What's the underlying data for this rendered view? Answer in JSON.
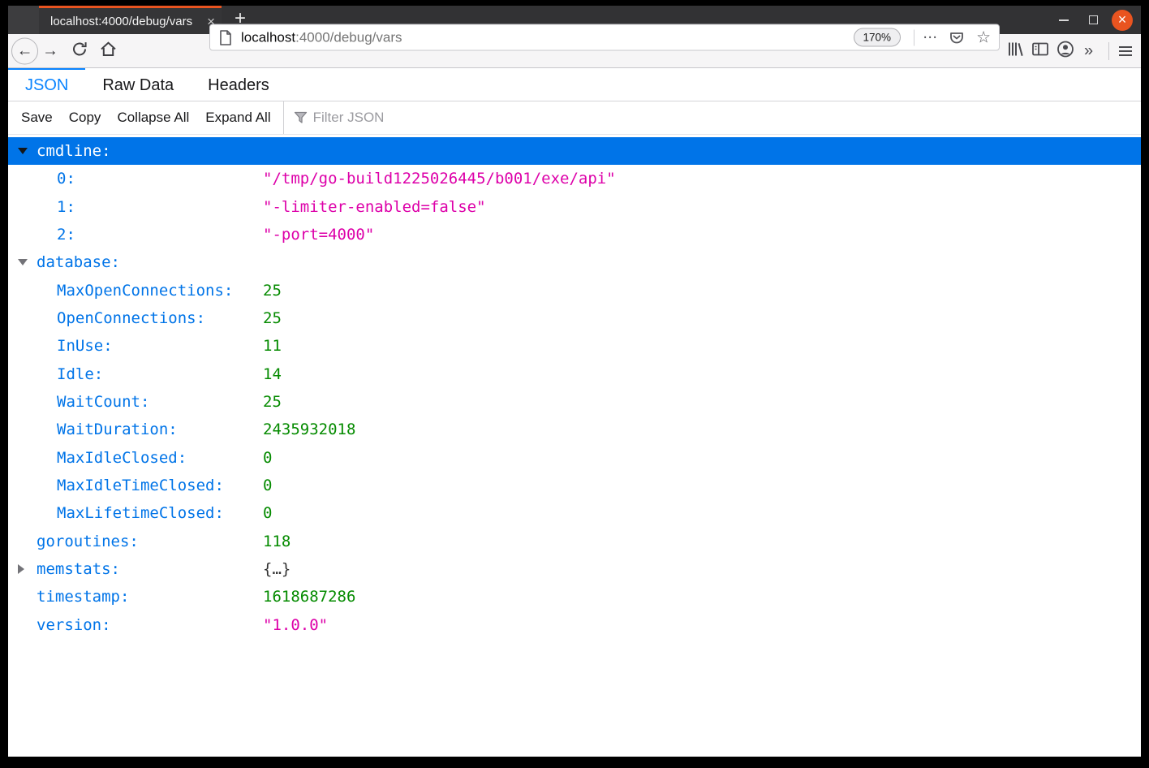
{
  "browser": {
    "tab_title": "localhost:4000/debug/vars",
    "new_tab_button": "+",
    "tab_close_glyph": "×",
    "url": {
      "host": "localhost",
      "path": ":4000/debug/vars"
    },
    "zoom_badge": "170%",
    "overflow_glyph": "»",
    "dots_glyph": "⋯",
    "star_glyph": "☆",
    "back_glyph": "←",
    "forward_glyph": "→",
    "close_window_glyph": "×"
  },
  "viewer": {
    "tabs": [
      {
        "label": "JSON",
        "active": true
      },
      {
        "label": "Raw Data",
        "active": false
      },
      {
        "label": "Headers",
        "active": false
      }
    ],
    "toolbar": {
      "buttons": [
        "Save",
        "Copy",
        "Collapse All",
        "Expand All"
      ],
      "filter_placeholder": "Filter JSON"
    }
  },
  "json_tree": {
    "rows": [
      {
        "key": "cmdline:",
        "depth": 0,
        "twisty": "open",
        "selected": true
      },
      {
        "key": "0:",
        "depth": 1,
        "value": "\"/tmp/go-build1225026445/b001/exe/api\"",
        "type": "string"
      },
      {
        "key": "1:",
        "depth": 1,
        "value": "\"-limiter-enabled=false\"",
        "type": "string"
      },
      {
        "key": "2:",
        "depth": 1,
        "value": "\"-port=4000\"",
        "type": "string"
      },
      {
        "key": "database:",
        "depth": 0,
        "twisty": "open"
      },
      {
        "key": "MaxOpenConnections:",
        "depth": 1,
        "value": "25",
        "type": "number"
      },
      {
        "key": "OpenConnections:",
        "depth": 1,
        "value": "25",
        "type": "number"
      },
      {
        "key": "InUse:",
        "depth": 1,
        "value": "11",
        "type": "number"
      },
      {
        "key": "Idle:",
        "depth": 1,
        "value": "14",
        "type": "number"
      },
      {
        "key": "WaitCount:",
        "depth": 1,
        "value": "25",
        "type": "number"
      },
      {
        "key": "WaitDuration:",
        "depth": 1,
        "value": "2435932018",
        "type": "number"
      },
      {
        "key": "MaxIdleClosed:",
        "depth": 1,
        "value": "0",
        "type": "number"
      },
      {
        "key": "MaxIdleTimeClosed:",
        "depth": 1,
        "value": "0",
        "type": "number"
      },
      {
        "key": "MaxLifetimeClosed:",
        "depth": 1,
        "value": "0",
        "type": "number"
      },
      {
        "key": "goroutines:",
        "depth": 0,
        "value": "118",
        "type": "number"
      },
      {
        "key": "memstats:",
        "depth": 0,
        "twisty": "closed",
        "value": "{…}",
        "type": "object"
      },
      {
        "key": "timestamp:",
        "depth": 0,
        "value": "1618687286",
        "type": "number"
      },
      {
        "key": "version:",
        "depth": 0,
        "value": "\"1.0.0\"",
        "type": "string"
      }
    ]
  },
  "colors": {
    "selection_bg": "#0074e8",
    "key": "#0074e8",
    "number": "#058b00",
    "string": "#dd00a9",
    "object_preview": "#333333",
    "active_tab_accent": "#0a84ff",
    "ubuntu_orange": "#e95420"
  }
}
